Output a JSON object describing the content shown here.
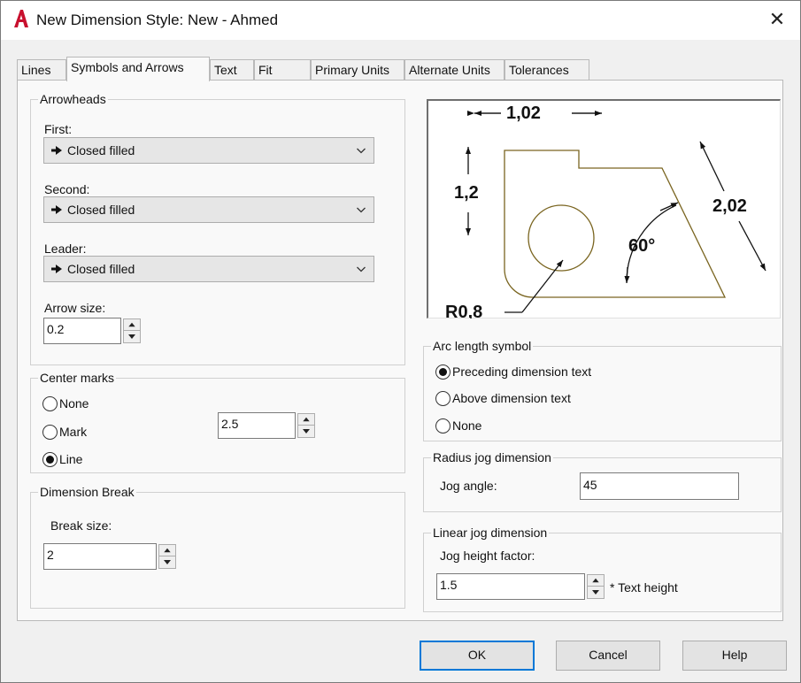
{
  "window": {
    "title": "New Dimension Style: New - Ahmed",
    "close_glyph": "✕",
    "app_icon": "autocad-icon",
    "accent_color": "#c8102e"
  },
  "tabs": [
    {
      "label": "Lines"
    },
    {
      "label": "Symbols and Arrows"
    },
    {
      "label": "Text"
    },
    {
      "label": "Fit"
    },
    {
      "label": "Primary Units"
    },
    {
      "label": "Alternate Units"
    },
    {
      "label": "Tolerances"
    }
  ],
  "active_tab": "Symbols and Arrows",
  "arrowheads": {
    "title": "Arrowheads",
    "first_label": "First:",
    "first_value": "Closed filled",
    "second_label": "Second:",
    "second_value": "Closed filled",
    "leader_label": "Leader:",
    "leader_value": "Closed filled",
    "size_label": "Arrow size:",
    "size_value": "0.2"
  },
  "center_marks": {
    "title": "Center marks",
    "options": [
      "None",
      "Mark",
      "Line"
    ],
    "selected": "Line",
    "size_value": "2.5"
  },
  "dimension_break": {
    "title": "Dimension Break",
    "size_label": "Break size:",
    "size_value": "2"
  },
  "preview": {
    "horizontal_dim": "1,02",
    "vertical_dim": "1,2",
    "aligned_dim": "2,02",
    "angle_dim": "60°",
    "radius_dim": "R0,8"
  },
  "arc_length": {
    "title": "Arc length symbol",
    "options": [
      "Preceding dimension text",
      "Above dimension text",
      "None"
    ],
    "selected": "Preceding dimension text"
  },
  "radius_jog": {
    "title": "Radius jog dimension",
    "angle_label": "Jog angle:",
    "angle_value": "45"
  },
  "linear_jog": {
    "title": "Linear jog dimension",
    "factor_label": "Jog height factor:",
    "factor_value": "1.5",
    "suffix": "* Text height"
  },
  "buttons": {
    "ok": "OK",
    "cancel": "Cancel",
    "help": "Help"
  },
  "colors": {
    "preview_geometry": "#7a6520",
    "focus_border": "#0078d7"
  }
}
